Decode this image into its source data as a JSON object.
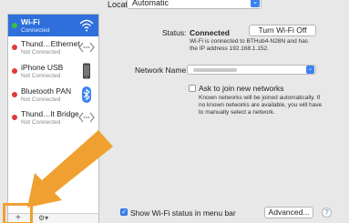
{
  "location": {
    "label": "Location:",
    "value": "Automatic"
  },
  "services": [
    {
      "name": "Wi-Fi",
      "status": "Connected",
      "dot": "#3cbf3c",
      "icon": "wifi-icon",
      "selected": true
    },
    {
      "name": "Thund…Ethernet",
      "status": "Not Connected",
      "dot": "#e03a3a",
      "icon": "ethernet-arrows-icon"
    },
    {
      "name": "iPhone USB",
      "status": "Not Connected",
      "dot": "#e03a3a",
      "icon": "iphone-icon"
    },
    {
      "name": "Bluetooth PAN",
      "status": "Not Connected",
      "dot": "#e03a3a",
      "icon": "bluetooth-icon"
    },
    {
      "name": "Thund…lt Bridge",
      "status": "Not Connected",
      "dot": "#e03a3a",
      "icon": "ethernet-arrows-icon"
    }
  ],
  "toolbar": {
    "add": "+",
    "remove": "-",
    "gear": "⚙▾"
  },
  "status": {
    "label": "Status:",
    "value": "Connected",
    "button": "Turn Wi-Fi Off",
    "detail_line1": "Wi-Fi is connected to BTHub4-N28N and has",
    "detail_line2": "the IP address 192.168.1.152."
  },
  "network_name": {
    "label": "Network Name:"
  },
  "ask_join": {
    "label": "Ask to join new networks",
    "checked": false,
    "help_line1": "Known networks will be joined automatically. If",
    "help_line2": "no known networks are available, you will have",
    "help_line3": "to manually select a network."
  },
  "show_wifi": {
    "label": "Show Wi-Fi status in menu bar",
    "checked": true
  },
  "advanced_button": "Advanced...",
  "help_button": "?",
  "colors": {
    "selected_row": "#2f6fdc",
    "accent": "#3b82f0",
    "highlight": "#f0a030"
  }
}
